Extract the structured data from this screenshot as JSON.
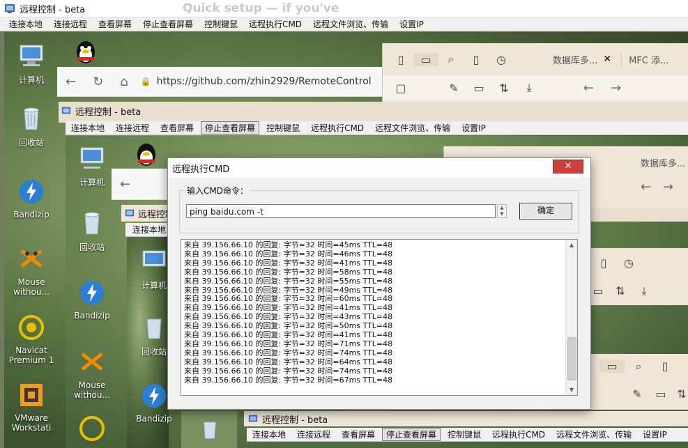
{
  "window_title": "远程控制 - beta",
  "menu": [
    "连接本地",
    "连接远程",
    "查看屏幕",
    "停止查看屏幕",
    "控制键鼠",
    "远程执行CMD",
    "远程文件浏览、传输",
    "设置IP"
  ],
  "menu_selected_index": 3,
  "desktop_icons": {
    "computer": "计算机",
    "recycle": "回收站",
    "bandizip": "Bandizip",
    "mouse": "Mouse withou...",
    "navicat": "Navicat Premium 1",
    "vmware": "VMware Workstati"
  },
  "background_text": "Quick setup — if you've",
  "browser": {
    "url": "https://github.com/zhin2929/RemoteControl",
    "tab1": "数据库多...",
    "tab2": "MFC 添...",
    "tab_short": "数据库多..."
  },
  "dialog": {
    "title": "远程执行CMD",
    "group_label": "输入CMD命令：",
    "input_value": "ping baidu.com -t",
    "ok_label": "确定",
    "output_lines": [
      "来自 39.156.66.10 的回复: 字节=32 时间=45ms TTL=48",
      "来自 39.156.66.10 的回复: 字节=32 时间=46ms TTL=48",
      "来自 39.156.66.10 的回复: 字节=32 时间=41ms TTL=48",
      "来自 39.156.66.10 的回复: 字节=32 时间=58ms TTL=48",
      "来自 39.156.66.10 的回复: 字节=32 时间=55ms TTL=48",
      "来自 39.156.66.10 的回复: 字节=32 时间=49ms TTL=48",
      "来自 39.156.66.10 的回复: 字节=32 时间=60ms TTL=48",
      "来自 39.156.66.10 的回复: 字节=32 时间=41ms TTL=48",
      "来自 39.156.66.10 的回复: 字节=32 时间=43ms TTL=48",
      "来自 39.156.66.10 的回复: 字节=32 时间=50ms TTL=48",
      "来自 39.156.66.10 的回复: 字节=32 时间=41ms TTL=48",
      "来自 39.156.66.10 的回复: 字节=32 时间=71ms TTL=48",
      "来自 39.156.66.10 的回复: 字节=32 时间=74ms TTL=48",
      "来自 39.156.66.10 的回复: 字节=32 时间=64ms TTL=48",
      "来自 39.156.66.10 的回复: 字节=32 时间=74ms TTL=48",
      "来自 39.156.66.10 的回复: 字节=32 时间=67ms TTL=48"
    ]
  },
  "icons": [
    "window-app-icon",
    "qq-icon",
    "computer-icon",
    "recycle-bin-icon",
    "bandizip-icon",
    "mouse-app-icon",
    "navicat-icon",
    "vmware-icon",
    "close-icon",
    "back-arrow-icon",
    "refresh-icon",
    "home-icon",
    "lock-icon",
    "sidebar-icon",
    "folder-icon",
    "search-icon",
    "bookmark-icon",
    "history-icon",
    "scroll-up-icon",
    "scroll-down-icon"
  ],
  "colors": {
    "close_red": "#c8413b",
    "titlebar": "#ffffff",
    "menubar": "#f0f0f0",
    "dialog_bg": "#f0f0f0"
  }
}
